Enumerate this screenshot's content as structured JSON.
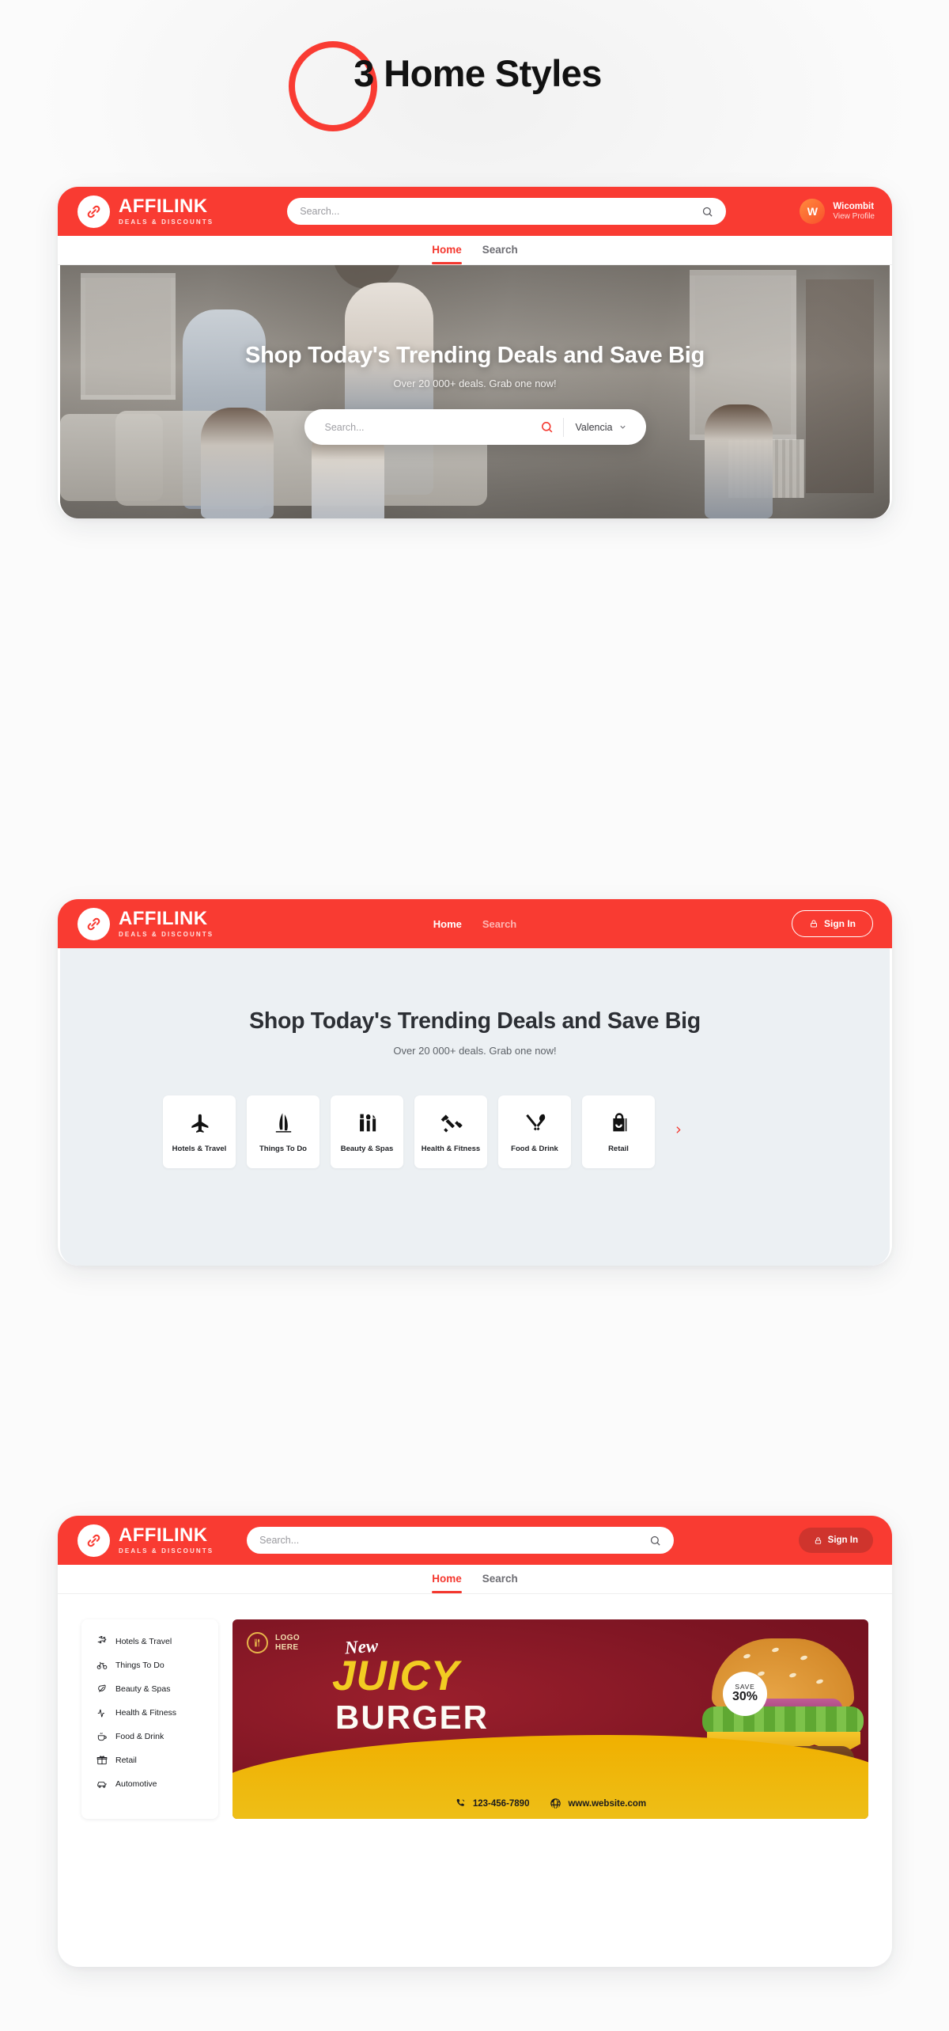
{
  "page": {
    "title": "3 Home Styles",
    "accent_red": "#f93b32",
    "accent_dark_red": "#cf342d",
    "body_bg": "#fbfbfb"
  },
  "brand": {
    "name": "AFFILINK",
    "tagline": "DEALS & DISCOUNTS",
    "icon": "link-chain-icon"
  },
  "card1": {
    "search": {
      "placeholder": "Search...",
      "icon": "search-icon"
    },
    "profile": {
      "avatar_letter": "W",
      "name": "Wicombit",
      "link": "View Profile"
    },
    "tabs": [
      {
        "label": "Home",
        "active": true
      },
      {
        "label": "Search",
        "active": false
      }
    ],
    "hero": {
      "heading": "Shop Today's Trending Deals and Save Big",
      "subheading": "Over 20 000+ deals. Grab one now!",
      "search_placeholder": "Search...",
      "location": "Valencia",
      "location_chevron": "chevron-down-icon"
    }
  },
  "card2": {
    "nav": [
      {
        "label": "Home",
        "active": true
      },
      {
        "label": "Search",
        "active": false
      }
    ],
    "signin": {
      "label": "Sign In",
      "icon": "lock-icon"
    },
    "hero": {
      "heading": "Shop Today's Trending Deals and Save Big",
      "subheading": "Over 20 000+ deals. Grab one now!"
    },
    "categories": [
      {
        "label": "Hotels & Travel",
        "icon": "airplane-icon"
      },
      {
        "label": "Things To Do",
        "icon": "landmark-icon"
      },
      {
        "label": "Beauty & Spas",
        "icon": "lipstick-brush-icon"
      },
      {
        "label": "Health & Fitness",
        "icon": "dumbbell-icon"
      },
      {
        "label": "Food & Drink",
        "icon": "fork-knife-icon"
      },
      {
        "label": "Retail",
        "icon": "shopping-bag-icon"
      }
    ],
    "next_arrow": "chevron-right-icon"
  },
  "card3": {
    "search": {
      "placeholder": "Search...",
      "icon": "search-icon"
    },
    "signin": {
      "label": "Sign In",
      "icon": "lock-icon"
    },
    "tabs": [
      {
        "label": "Home",
        "active": true
      },
      {
        "label": "Search",
        "active": false
      }
    ],
    "sidebar": [
      {
        "label": "Hotels & Travel",
        "icon": "airplane-icon"
      },
      {
        "label": "Things To Do",
        "icon": "bicycle-icon"
      },
      {
        "label": "Beauty & Spas",
        "icon": "leaf-icon"
      },
      {
        "label": "Health & Fitness",
        "icon": "pulse-icon"
      },
      {
        "label": "Food & Drink",
        "icon": "coffee-cup-icon"
      },
      {
        "label": "Retail",
        "icon": "gift-icon"
      },
      {
        "label": "Automotive",
        "icon": "car-icon"
      }
    ],
    "promo": {
      "logo_line1": "LOGO",
      "logo_line2": "HERE",
      "logo_icon": "cutlery-badge-icon",
      "word_new": "New",
      "word_juicy": "JUICY",
      "word_burger": "BURGER",
      "save_label": "SAVE",
      "save_value": "30%",
      "phone": "123-456-7890",
      "phone_icon": "phone-icon",
      "website": "www.website.com",
      "website_icon": "globe-icon"
    }
  }
}
